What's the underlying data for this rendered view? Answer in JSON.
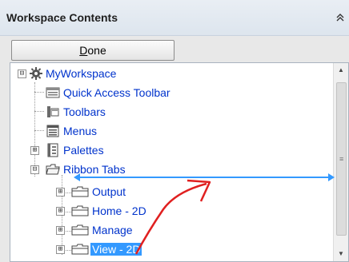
{
  "header": {
    "title": "Workspace Contents",
    "collapse_icon": "double-chevron-up-icon"
  },
  "toolbar": {
    "done_mnemonic": "D",
    "done_rest": "one"
  },
  "tree": {
    "root": {
      "label": "MyWorkspace",
      "expander": "⊟",
      "icon": "gear-icon"
    },
    "items": [
      {
        "label": "Quick Access Toolbar",
        "icon": "toolbar-icon"
      },
      {
        "label": "Toolbars",
        "icon": "toolbars-icon"
      },
      {
        "label": "Menus",
        "icon": "menus-icon"
      },
      {
        "label": "Palettes",
        "icon": "palettes-icon",
        "expander": "⊞"
      },
      {
        "label": "Ribbon Tabs",
        "icon": "folder-open-icon",
        "expander": "⊟"
      }
    ],
    "ribbon_children": [
      {
        "label": "Output",
        "expander": "⊞"
      },
      {
        "label": "Home - 2D",
        "expander": "⊞"
      },
      {
        "label": "Manage",
        "expander": "⊞"
      },
      {
        "label": "View - 2D",
        "expander": "⊞",
        "selected": true
      }
    ]
  },
  "colors": {
    "drop_line": "#3399ff",
    "arrow": "#e02020",
    "selection": "#3399ff",
    "link_text": "#0033cc"
  }
}
